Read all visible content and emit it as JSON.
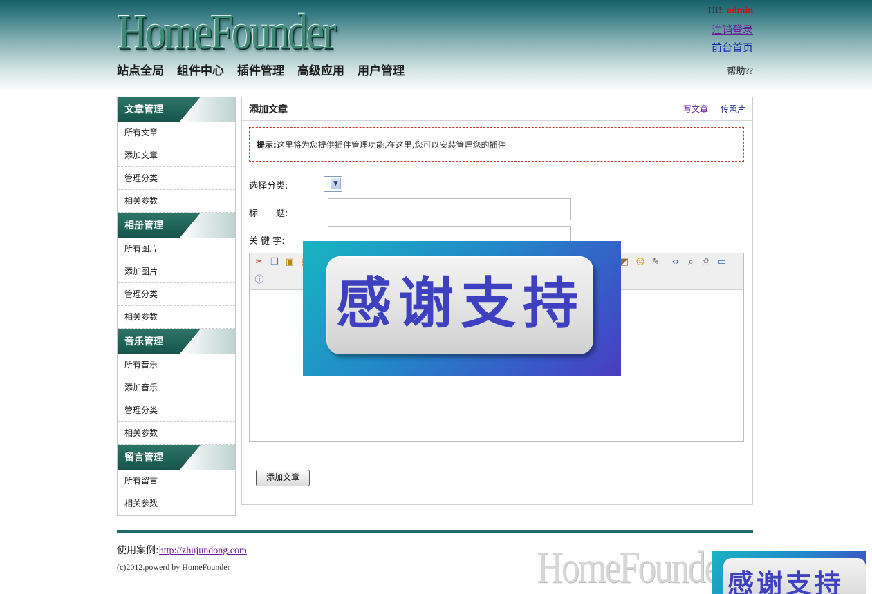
{
  "header": {
    "logo": "HomeFounder",
    "greeting": "HI!:",
    "username": "admin",
    "logout": "注销登录",
    "frontpage": "前台首页",
    "help": "帮助??",
    "nav": [
      "站点全局",
      "组件中心",
      "插件管理",
      "高级应用",
      "用户管理"
    ]
  },
  "sidebar": {
    "sections": [
      {
        "title": "文章管理",
        "items": [
          "所有文章",
          "添加文章",
          "管理分类",
          "相关参数"
        ]
      },
      {
        "title": "相册管理",
        "items": [
          "所有图片",
          "添加图片",
          "管理分类",
          "相关参数"
        ]
      },
      {
        "title": "音乐管理",
        "items": [
          "所有音乐",
          "添加音乐",
          "管理分类",
          "相关参数"
        ]
      },
      {
        "title": "留言管理",
        "items": [
          "所有留言",
          "相关参数"
        ]
      }
    ]
  },
  "panel": {
    "title": "添加文章",
    "write_link": "写文章",
    "photo_link": "传照片",
    "tip_label": "提示:",
    "tip_text": "这里将为您提供插件管理功能,在这里,您可以安装管理您的插件",
    "category_label": "选择分类:",
    "title_label": "标　　题:",
    "keywords_label": "关 键 字:",
    "submit": "添加文章"
  },
  "overlay": {
    "text": "感谢支持"
  },
  "footer": {
    "case_label": "使用案例:",
    "case_link": "http://zhujundong.com",
    "copyright": "(c)2012.powerd by HomeFounder",
    "watermark": "HomeFounder"
  }
}
